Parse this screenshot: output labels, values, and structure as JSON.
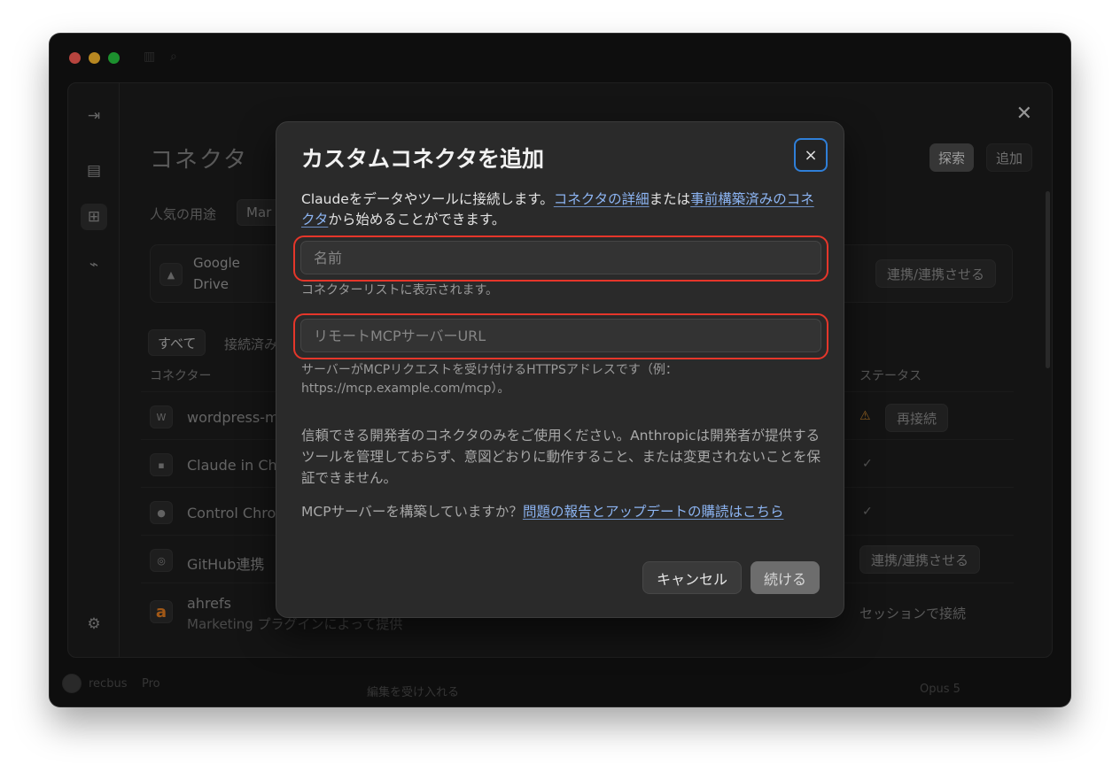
{
  "background": {
    "page_title": "コネクタ",
    "explore_label": "探索",
    "add_label": "追加",
    "popular_label": "人気の用途",
    "popular_chip": "Mar",
    "feature_card": {
      "name_line1": "Google",
      "name_line2": "Drive",
      "connect_label": "連携/連携させる"
    },
    "filter_all": "すべて",
    "filter_connected": "接続済み",
    "col_connector": "コネクター",
    "col_status": "ステータス",
    "rows": [
      {
        "icon": "W",
        "name": "wordpress-m",
        "status_button": "再接続"
      },
      {
        "icon": "▪",
        "name": "Claude in Ch"
      },
      {
        "icon": "●",
        "name": "Control Chro"
      },
      {
        "icon": "◎",
        "name": "GitHub連携",
        "status_button": "連携/連携させる"
      },
      {
        "icon": "a",
        "name": "ahrefs",
        "sub": "Marketing プラグインによって提供",
        "status_text": "セッションで接続"
      }
    ],
    "bottom": {
      "user": "recbus",
      "plan": "Pro",
      "prompt": "編集を受け入れる",
      "model": "Opus 5"
    }
  },
  "modal": {
    "title": "カスタムコネクタを追加",
    "close_label": "×",
    "desc_prefix": "Claudeをデータやツールに接続します。",
    "desc_link1": "コネクタの詳細",
    "desc_mid": "または",
    "desc_link2": "事前構築済みのコネクタ",
    "desc_suffix": "から始めることができます。",
    "name_placeholder": "名前",
    "name_hint": "コネクターリストに表示されます。",
    "url_placeholder": "リモートMCPサーバーURL",
    "url_hint": "サーバーがMCPリクエストを受け付けるHTTPSアドレスです（例：https://mcp.example.com/mcp）。",
    "warning": "信頼できる開発者のコネクタのみをご使用ください。Anthropicは開発者が提供するツールを管理しておらず、意図どおりに動作すること、または変更されないことを保証できません。",
    "mcp_question": "MCPサーバーを構築していますか？",
    "mcp_link": "問題の報告とアップデートの購読はこちら",
    "cancel_label": "キャンセル",
    "continue_label": "続ける"
  }
}
